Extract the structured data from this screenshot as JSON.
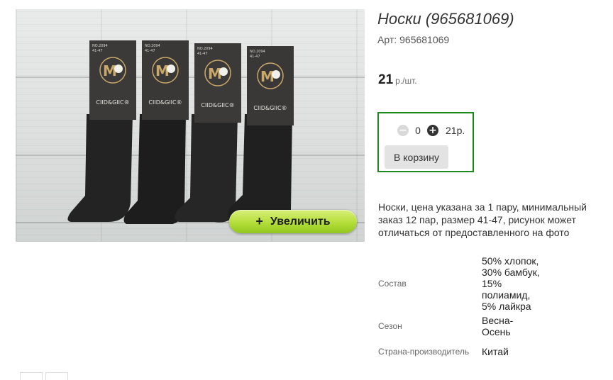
{
  "product": {
    "title": "Носки (965681069)",
    "sku_label": "Арт:",
    "sku_value": "965681069",
    "price_value": "21",
    "price_unit": "р./шт."
  },
  "cart": {
    "quantity": "0",
    "line_total": "21р.",
    "add_to_cart_label": "В корзину",
    "minus_symbol": "−",
    "plus_symbol": "+"
  },
  "gallery": {
    "zoom_plus": "+",
    "zoom_label": "Увеличить",
    "package_brand": "CIID&GIIC®",
    "package_code": "NO.2094",
    "package_size": "41-47",
    "logo_letter": "M"
  },
  "description": "Носки, цена указана за 1 пару, минимальный заказ 12 пар, размер 41-47, рисунок может отличаться от предоставленного на фото",
  "specs": [
    {
      "label": "Состав",
      "value": "50% хлопок,\n30% бамбук,\n15%\nполиамид,\n5% лайкра"
    },
    {
      "label": "Сезон",
      "value": "Весна-\nОсень"
    },
    {
      "label": "Страна-производитель",
      "value": "Китай"
    }
  ]
}
